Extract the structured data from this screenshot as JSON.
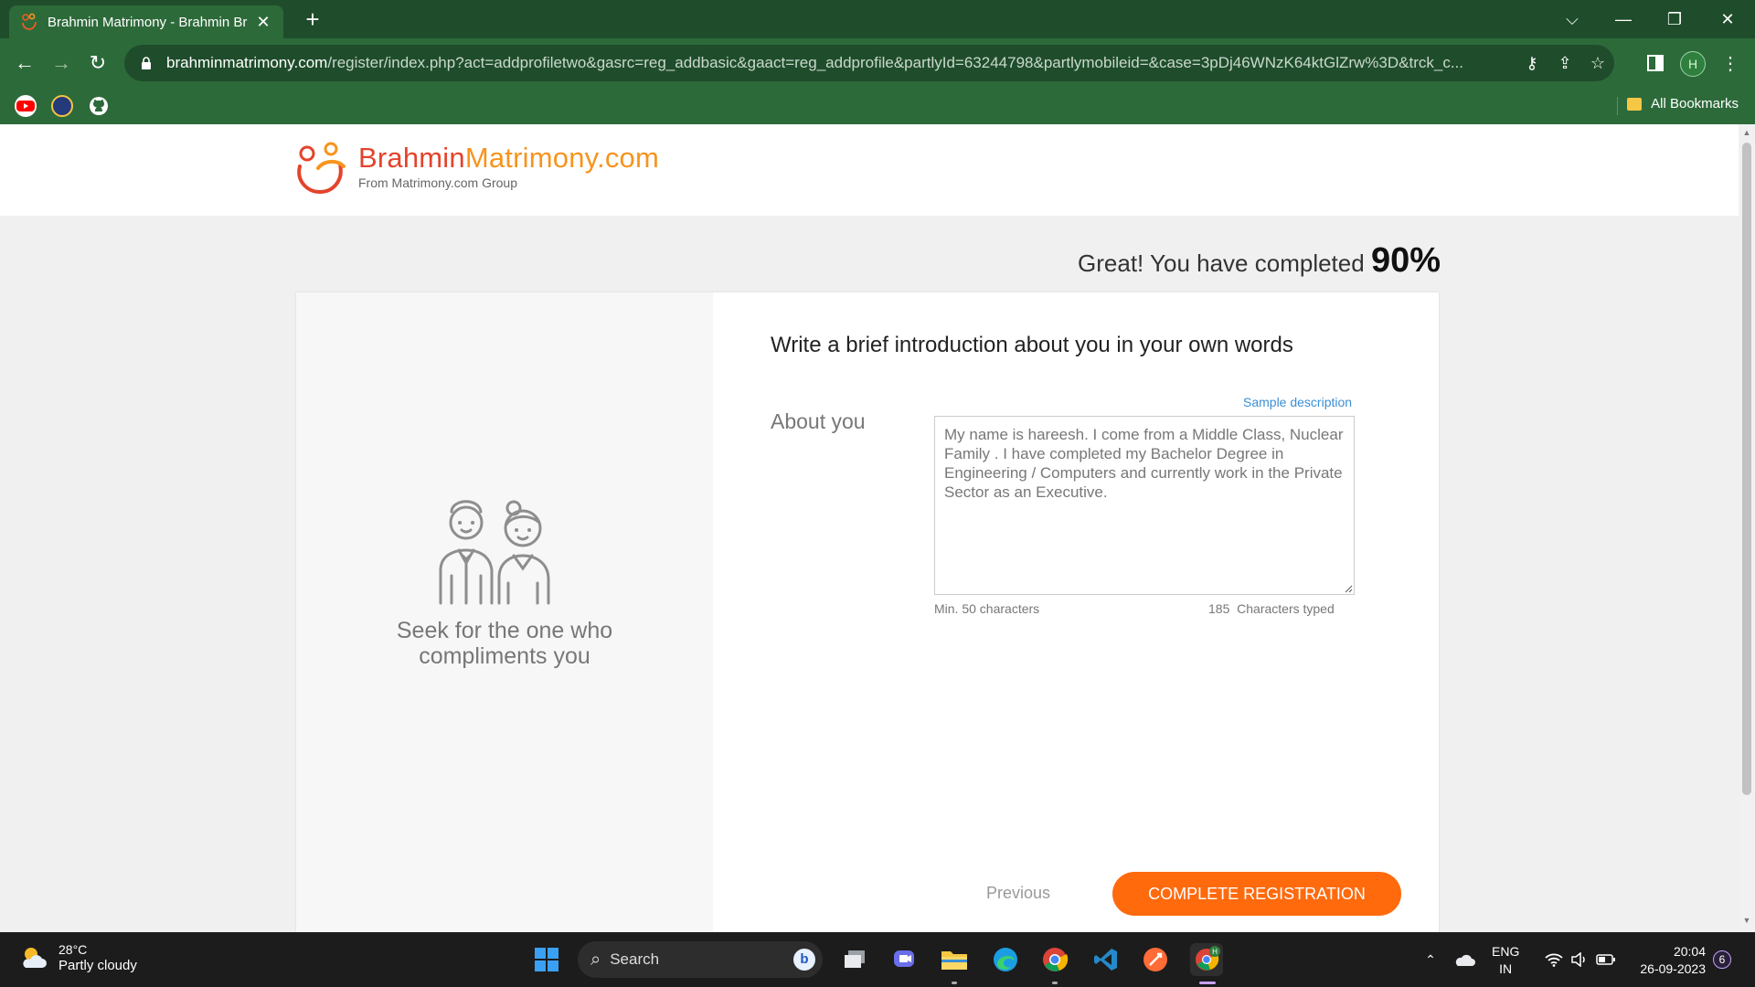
{
  "browser": {
    "tab_title": "Brahmin Matrimony - Brahmin Br",
    "url_host": "brahminmatrimony.com",
    "url_path": "/register/index.php?act=addprofiletwo&gasrc=reg_addbasic&gaact=reg_addprofile&partlyId=63244798&partlymobileid=&case=3pDj46WNzK64ktGlZrw%3D&trck_c...",
    "profile_initial": "H",
    "all_bookmarks_label": "All Bookmarks"
  },
  "site": {
    "logo_brahmin": "Brahmin",
    "logo_matrimony": "Matrimony.com",
    "logo_sub": "From Matrimony.com Group"
  },
  "progress": {
    "text": "Great! You have completed",
    "percent_label": "90%",
    "percent": 90
  },
  "left_panel": {
    "tagline_line1": "Seek for the one who",
    "tagline_line2": "compliments you"
  },
  "form": {
    "title": "Write a brief introduction about you in your own words",
    "sample_link": "Sample description",
    "about_label": "About you",
    "about_value": "My name is hareesh. I come from a Middle Class, Nuclear Family . I have completed my Bachelor Degree in Engineering / Computers and currently work in the Private Sector as an Executive.",
    "min_hint": "Min. 50 characters",
    "count_value": "185",
    "count_suffix": "Characters typed",
    "previous_label": "Previous",
    "complete_label": "COMPLETE REGISTRATION"
  },
  "taskbar": {
    "weather_temp": "28°C",
    "weather_desc": "Partly cloudy",
    "search_label": "Search",
    "lang_line1": "ENG",
    "lang_line2": "IN",
    "time": "20:04",
    "date": "26-09-2023",
    "notifications": "6"
  },
  "colors": {
    "chrome_dark": "#1f4d2b",
    "chrome": "#2d6a3a",
    "accent_orange": "#ff6a0d",
    "link_blue": "#3a8fd6"
  }
}
